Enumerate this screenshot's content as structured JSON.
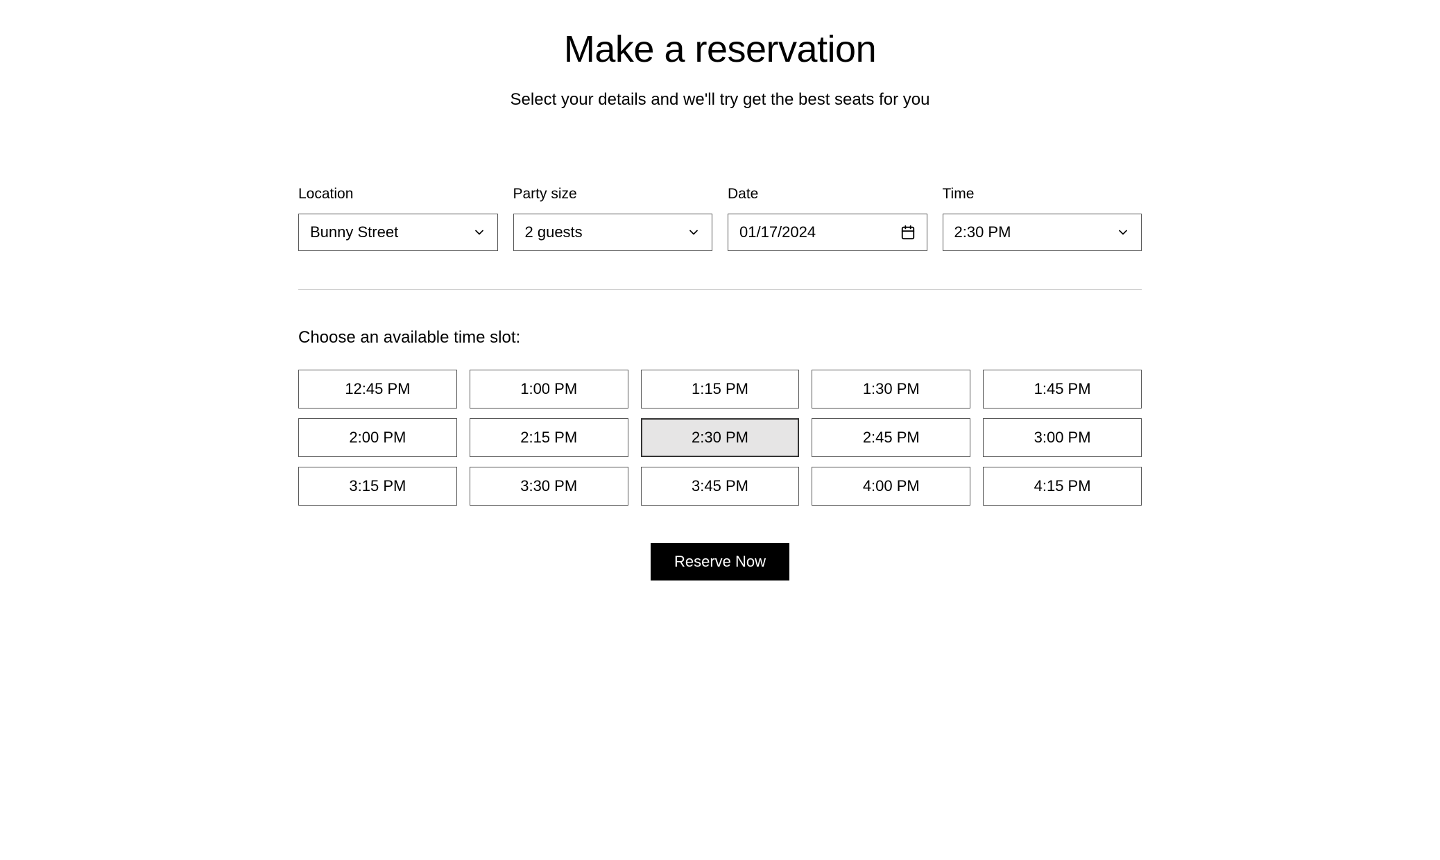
{
  "header": {
    "title": "Make a reservation",
    "subtitle": "Select your details and we'll try get the best seats for you"
  },
  "fields": {
    "location": {
      "label": "Location",
      "value": "Bunny Street"
    },
    "party_size": {
      "label": "Party size",
      "value": "2 guests"
    },
    "date": {
      "label": "Date",
      "value": "01/17/2024"
    },
    "time": {
      "label": "Time",
      "value": "2:30 PM"
    }
  },
  "slots": {
    "prompt": "Choose an available time slot:",
    "items": [
      {
        "label": "12:45 PM",
        "selected": false
      },
      {
        "label": "1:00 PM",
        "selected": false
      },
      {
        "label": "1:15 PM",
        "selected": false
      },
      {
        "label": "1:30 PM",
        "selected": false
      },
      {
        "label": "1:45 PM",
        "selected": false
      },
      {
        "label": "2:00 PM",
        "selected": false
      },
      {
        "label": "2:15 PM",
        "selected": false
      },
      {
        "label": "2:30 PM",
        "selected": true
      },
      {
        "label": "2:45 PM",
        "selected": false
      },
      {
        "label": "3:00 PM",
        "selected": false
      },
      {
        "label": "3:15 PM",
        "selected": false
      },
      {
        "label": "3:30 PM",
        "selected": false
      },
      {
        "label": "3:45 PM",
        "selected": false
      },
      {
        "label": "4:00 PM",
        "selected": false
      },
      {
        "label": "4:15 PM",
        "selected": false
      }
    ]
  },
  "actions": {
    "reserve_label": "Reserve Now"
  }
}
